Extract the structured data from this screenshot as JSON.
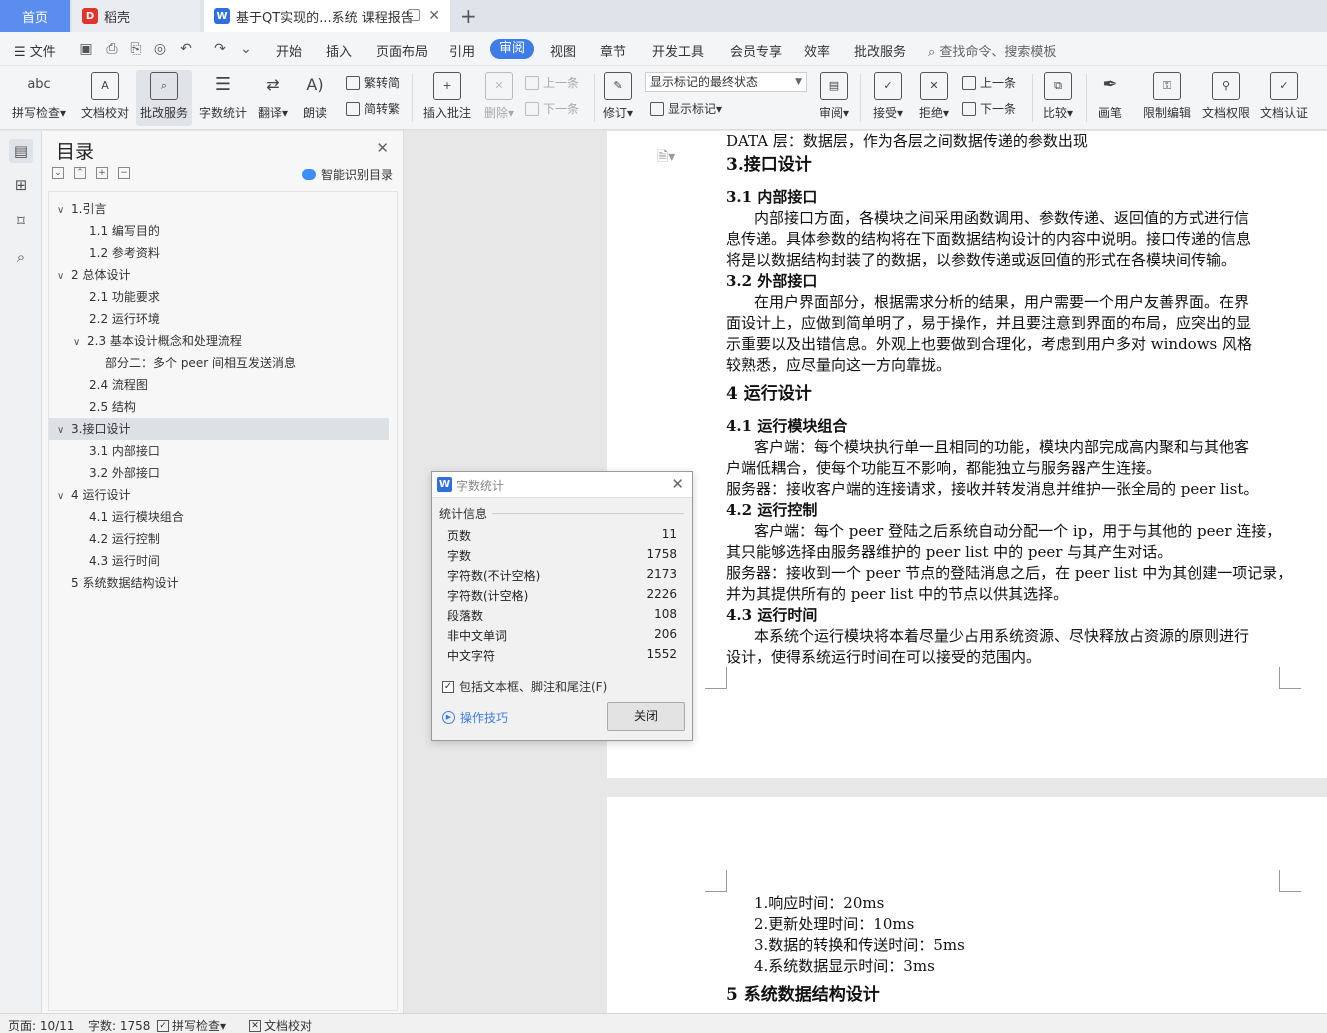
{
  "titlebar": {
    "home_tab": "首页",
    "daoke_tab": "稻壳",
    "doc_tab": "基于QT实现的...系统 课程报告"
  },
  "menubar": {
    "file": "文件",
    "items": [
      "开始",
      "插入",
      "页面布局",
      "引用",
      "审阅",
      "视图",
      "章节",
      "开发工具",
      "会员专享",
      "效率",
      "批改服务"
    ],
    "active": "审阅",
    "search_placeholder": "查找命令、搜索模板"
  },
  "ribbon": {
    "spell_check": "拼写检查",
    "doc_proof": "文档校对",
    "correction_service": "批改服务",
    "word_count": "字数统计",
    "translate": "翻译",
    "read_aloud": "朗读",
    "trad_simp": "繁转简",
    "simp_trad": "简转繁",
    "insert_comment": "插入批注",
    "delete": "删除",
    "prev": "上一条",
    "next": "下一条",
    "revise": "修订",
    "markup_select": "显示标记的最终状态",
    "show_markup": "显示标记",
    "review": "审阅",
    "accept": "接受",
    "reject": "拒绝",
    "prev2": "上一条",
    "next2": "下一条",
    "compare": "比较",
    "pen": "画笔",
    "restrict_edit": "限制编辑",
    "doc_permission": "文档权限",
    "doc_certify": "文档认证"
  },
  "toc": {
    "title": "目录",
    "smart": "智能识别目录",
    "items": [
      {
        "label": "1.引言",
        "caret": "∨"
      },
      {
        "label": "1.1 编写目的",
        "caret": ""
      },
      {
        "label": "1.2 参考资料",
        "caret": ""
      },
      {
        "label": "2 总体设计",
        "caret": "∨"
      },
      {
        "label": "2.1  功能要求",
        "caret": ""
      },
      {
        "label": "2.2 运行环境",
        "caret": ""
      },
      {
        "label": "2.3 基本设计概念和处理流程",
        "caret": "∨"
      },
      {
        "label": "部分二：多个 peer 间相互发送消息",
        "caret": ""
      },
      {
        "label": "2.4 流程图",
        "caret": ""
      },
      {
        "label": "2.5 结构",
        "caret": ""
      },
      {
        "label": "3.接口设计",
        "caret": "∨"
      },
      {
        "label": "3.1 内部接口",
        "caret": ""
      },
      {
        "label": "3.2 外部接口",
        "caret": ""
      },
      {
        "label": "4 运行设计",
        "caret": "∨"
      },
      {
        "label": "4.1 运行模块组合",
        "caret": ""
      },
      {
        "label": "4.2 运行控制",
        "caret": ""
      },
      {
        "label": "4.3 运行时间",
        "caret": ""
      },
      {
        "label": "5 系统数据结构设计",
        "caret": ""
      }
    ],
    "selected": "3.接口设计"
  },
  "document": {
    "page1": [
      "DATA 层：数据层，作为各层之间数据传递的参数出现",
      "3.接口设计",
      "3.1 内部接口",
      "内部接口方面，各模块之间采用函数调用、参数传递、返回值的方式进行信",
      "息传递。具体参数的结构将在下面数据结构设计的内容中说明。接口传递的信息",
      "将是以数据结构封装了的数据，以参数传递或返回值的形式在各模块间传输。",
      "3.2 外部接口",
      "在用户界面部分，根据需求分析的结果，用户需要一个用户友善界面。在界",
      "面设计上，应做到简单明了，易于操作，并且要注意到界面的布局，应突出的显",
      "示重要以及出错信息。外观上也要做到合理化，考虑到用户多对 windows 风格",
      "较熟悉，应尽量向这一方向靠拢。",
      "4 运行设计",
      "4.1 运行模块组合",
      "客户端：每个模块执行单一且相同的功能，模块内部完成高内聚和与其他客",
      "户端低耦合，使每个功能互不影响，都能独立与服务器产生连接。",
      "服务器：接收客户端的连接请求，接收并转发消息并维护一张全局的 peer list。",
      "4.2 运行控制",
      "客户端：每个 peer 登陆之后系统自动分配一个 ip，用于与其他的 peer 连接，",
      "其只能够选择由服务器维护的 peer list 中的 peer 与其产生对话。",
      "服务器：接收到一个 peer 节点的登陆消息之后，在 peer list 中为其创建一项记录，",
      "并为其提供所有的 peer list 中的节点以供其选择。",
      "4.3 运行时间",
      "本系统个运行模块将本着尽量少占用系统资源、尽快释放占资源的原则进行",
      "设计，使得系统运行时间在可以接受的范围内。"
    ],
    "page2": [
      "1.响应时间：20ms",
      "2.更新处理时间：10ms",
      "3.数据的转换和传送时间：5ms",
      "4.系统数据显示时间：3ms",
      "5 系统数据结构设计"
    ]
  },
  "dialog": {
    "title": "字数统计",
    "section": "统计信息",
    "stats": [
      {
        "label": "页数",
        "value": "11"
      },
      {
        "label": "字数",
        "value": "1758"
      },
      {
        "label": "字符数(不计空格)",
        "value": "2173"
      },
      {
        "label": "字符数(计空格)",
        "value": "2226"
      },
      {
        "label": "段落数",
        "value": "108"
      },
      {
        "label": "非中文单词",
        "value": "206"
      },
      {
        "label": "中文字符",
        "value": "1552"
      }
    ],
    "include_label": "包括文本框、脚注和尾注(F)",
    "include_checked": true,
    "tips": "操作技巧",
    "close": "关闭"
  },
  "statusbar": {
    "page": "页面: 10/11",
    "words": "字数: 1758",
    "spell": "拼写检查",
    "proof": "文档校对"
  },
  "colors": {
    "accent": "#3e7ce8",
    "home_tab": "#5b8def"
  }
}
